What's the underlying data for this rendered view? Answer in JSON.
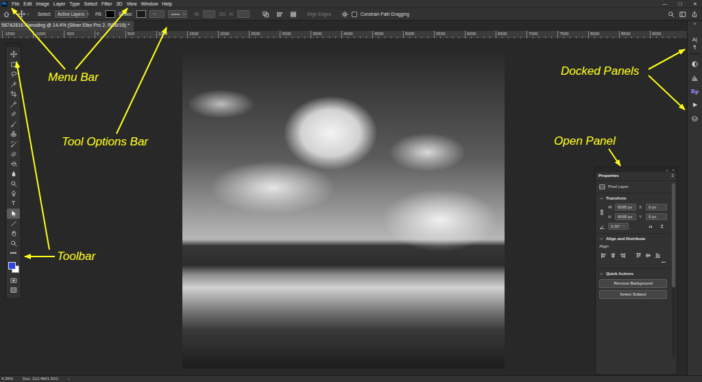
{
  "menu_bar": {
    "logo": "Ps",
    "items": [
      "File",
      "Edit",
      "Image",
      "Layer",
      "Type",
      "Select",
      "Filter",
      "3D",
      "View",
      "Window",
      "Help"
    ],
    "window_controls": [
      "—",
      "☐",
      "✕"
    ]
  },
  "options_bar": {
    "select_label": "Select:",
    "select_value": "Active Layers",
    "fill_label": "Fill:",
    "fill_color": "#000000",
    "stroke_label": "Stroke:",
    "stroke_color": "#1b1b1b",
    "w_label": "W:",
    "link_label": "GO",
    "h_label": "H:",
    "size_disabled": true,
    "align_edges": "Align Edges",
    "align_edges_disabled": true,
    "constrain_label": "Constrain Path Dragging",
    "constrain_checked": false
  },
  "document": {
    "title": "587A2816-Panoding @ 14.4% (Silver Efex Pro 2, RGB/16) *"
  },
  "ruler": {
    "labels": [
      "-1500",
      "-1000",
      "-500",
      "0",
      "500",
      "1000",
      "1500",
      "2000",
      "2500",
      "3000",
      "3500",
      "4000",
      "4500",
      "5000",
      "5500",
      "6000",
      "6500",
      "7000",
      "7500",
      "8000",
      "8500",
      "9000"
    ]
  },
  "toolbar": {
    "tools": [
      {
        "kind": "move",
        "selected": false
      },
      {
        "kind": "marquee",
        "selected": false
      },
      {
        "kind": "lasso",
        "selected": false
      },
      {
        "kind": "wand",
        "selected": false
      },
      {
        "kind": "crop",
        "selected": false
      },
      {
        "kind": "eyedropper",
        "selected": false
      },
      {
        "kind": "healing",
        "selected": false
      },
      {
        "kind": "brush",
        "selected": false
      },
      {
        "kind": "stamp",
        "selected": false
      },
      {
        "kind": "history",
        "selected": false
      },
      {
        "kind": "eraser",
        "selected": false
      },
      {
        "kind": "bucket",
        "selected": false
      },
      {
        "kind": "blur",
        "selected": false
      },
      {
        "kind": "dodge",
        "selected": false
      },
      {
        "kind": "pen",
        "selected": false
      },
      {
        "kind": "text",
        "label": "T",
        "selected": false
      },
      {
        "kind": "path",
        "selected": true
      },
      {
        "kind": "line",
        "selected": false
      },
      {
        "kind": "hand",
        "selected": false
      },
      {
        "kind": "zoom",
        "selected": false
      },
      {
        "kind": "text",
        "label": "•••",
        "selected": false
      }
    ],
    "colors": {
      "foreground": "#2f45e0",
      "background": "#ffffff"
    }
  },
  "dock": {
    "collapse": "»",
    "items": [
      {
        "kind": "text",
        "label": "A|"
      },
      {
        "kind": "text",
        "label": "¶"
      },
      {
        "kind": "adjust"
      },
      {
        "kind": "histogram"
      },
      {
        "kind": "plugin",
        "label": "Rp"
      },
      {
        "kind": "text",
        "label": "▶"
      },
      {
        "kind": "layers"
      }
    ]
  },
  "properties": {
    "controls": {
      "collapse": "«",
      "close": "×"
    },
    "title": "Properties",
    "menu": "≡",
    "layer_type": "Pixel Layer",
    "transform": {
      "title": "Transform",
      "expanded": true,
      "linked": true,
      "angle": "0.00°",
      "fields": [
        {
          "label": "W",
          "value": "6095 px"
        },
        {
          "label": "X",
          "value": "0 px"
        },
        {
          "label": "H",
          "value": "6095 px"
        },
        {
          "label": "Y",
          "value": "0 px"
        }
      ]
    },
    "align": {
      "title": "Align and Distribute",
      "expanded": true,
      "label": "Align:",
      "more": "•••"
    },
    "quick_actions": {
      "title": "Quick Actions",
      "expanded": true,
      "buttons": [
        "Remove Background",
        "Select Subject"
      ]
    }
  },
  "status_bar": {
    "zoom": "4.39%",
    "doc": "Doc: 212.4M/1.52G",
    "more": "›"
  },
  "annotations": [
    {
      "label": "Menu Bar"
    },
    {
      "label": "Tool Options Bar"
    },
    {
      "label": "Toolbar"
    },
    {
      "label": "Docked Panels"
    },
    {
      "label": "Open Panel"
    }
  ]
}
